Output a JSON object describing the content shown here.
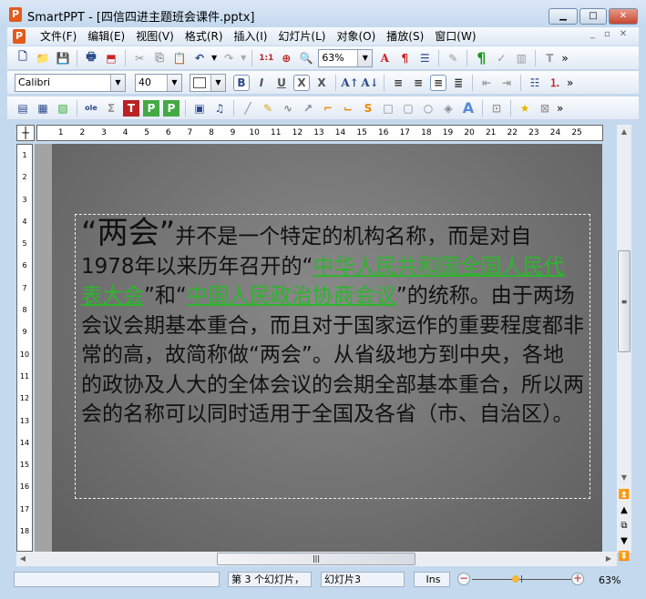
{
  "window": {
    "app_icon": "P",
    "title": "SmartPPT - [四信四进主题班会课件.pptx]"
  },
  "menu": [
    "文件(F)",
    "编辑(E)",
    "视图(V)",
    "格式(R)",
    "插入(I)",
    "幻灯片(L)",
    "对象(O)",
    "播放(S)",
    "窗口(W)"
  ],
  "toolbar": {
    "zoom": "63%",
    "font": "Calibri",
    "size": "40",
    "more": "»"
  },
  "ruler": {
    "h": [
      "1",
      "2",
      "3",
      "4",
      "5",
      "6",
      "7",
      "8",
      "9",
      "10",
      "11",
      "12",
      "13",
      "14",
      "15",
      "16",
      "17",
      "18",
      "19",
      "20",
      "21",
      "22",
      "23",
      "24",
      "25"
    ],
    "v": [
      "1",
      "2",
      "3",
      "4",
      "5",
      "6",
      "7",
      "8",
      "9",
      "10",
      "11",
      "12",
      "13",
      "14",
      "15",
      "16",
      "17",
      "18"
    ]
  },
  "slide": {
    "big": "“两会”",
    "t1": "并不是一个特定的机构名称，而是对自1978年以来历年召开的“",
    "link1": "中华人民共和国全国人民代表大会",
    "t2": "”和“",
    "link2": "中国人民政治协商会议",
    "t3": "”的统称。由于两场会议会期基本重合，而且对于国家运作的重要程度都非常的高，故简称做“两会”。从省级地方到中央，各地的政协及人大的全体会议的会期全部基本重合，所以两会的名称可以同时适用于全国及各省（市、自治区）。",
    "link_color": "#2db52d"
  },
  "status": {
    "slide_num": "第 3 个幻灯片，",
    "slide_name": "幻灯片3",
    "mode": "Ins",
    "zoom": "63%",
    "zoom_slider_fraction": 0.4
  }
}
